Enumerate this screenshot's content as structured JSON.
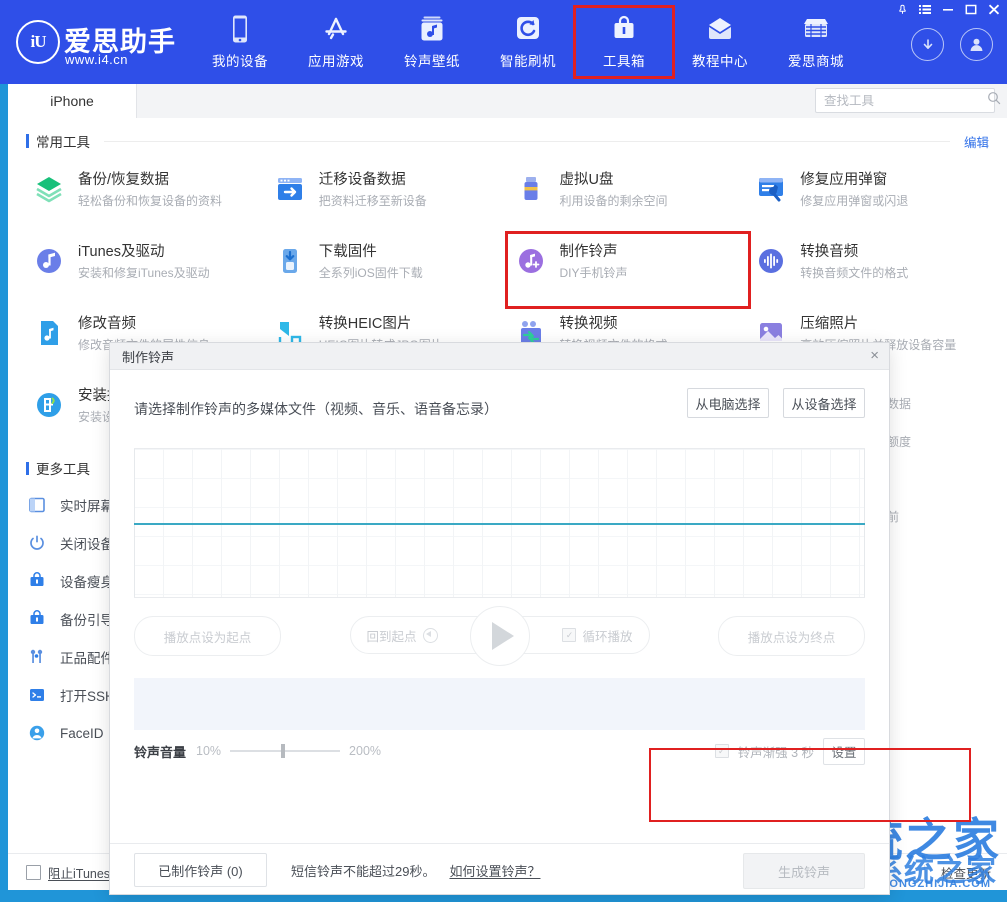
{
  "window": {
    "controls": [
      "pin-icon",
      "list-icon",
      "minimize-icon",
      "maximize-icon",
      "close-icon"
    ]
  },
  "brand": {
    "mark": "iU",
    "name": "爱思助手",
    "url": "www.i4.cn"
  },
  "nav": {
    "items": [
      {
        "label": "我的设备",
        "icon": "phone-icon"
      },
      {
        "label": "应用游戏",
        "icon": "appstore-icon"
      },
      {
        "label": "铃声壁纸",
        "icon": "music-box-icon"
      },
      {
        "label": "智能刷机",
        "icon": "refresh-icon"
      },
      {
        "label": "工具箱",
        "icon": "toolbox-icon",
        "selected": true
      },
      {
        "label": "教程中心",
        "icon": "envelope-icon"
      },
      {
        "label": "爱思商城",
        "icon": "shop-icon"
      }
    ],
    "right": [
      {
        "name": "download-icon"
      },
      {
        "name": "user-avatar-icon"
      }
    ],
    "highlight_color": "#e02020",
    "bar_color": "#2f4fe8"
  },
  "tabstrip": {
    "device_tab": "iPhone",
    "search_placeholder": "查找工具",
    "search_value": ""
  },
  "common_tools": {
    "title": "常用工具",
    "edit_label": "编辑",
    "items": [
      {
        "name": "备份/恢复数据",
        "desc": "轻松备份和恢复设备的资料",
        "icon": "layers-icon",
        "color": "#18c07a"
      },
      {
        "name": "迁移设备数据",
        "desc": "把资料迁移至新设备",
        "icon": "transfer-icon",
        "color": "#2f7fe8"
      },
      {
        "name": "虚拟U盘",
        "desc": "利用设备的剩余空间",
        "icon": "usb-icon",
        "color": "#6a7ee8"
      },
      {
        "name": "修复应用弹窗",
        "desc": "修复应用弹窗或闪退",
        "icon": "wrench-window-icon",
        "color": "#2f7fe8"
      },
      {
        "name": "iTunes及驱动",
        "desc": "安装和修复iTunes及驱动",
        "icon": "music-note-icon",
        "color": "#6a7ee8"
      },
      {
        "name": "下载固件",
        "desc": "全系列iOS固件下载",
        "icon": "download-box-icon",
        "color": "#2f9fe8"
      },
      {
        "name": "制作铃声",
        "desc": "DIY手机铃声",
        "icon": "ringtone-icon",
        "color": "#9b6fe0",
        "selected": true
      },
      {
        "name": "转换音频",
        "desc": "转换音频文件的格式",
        "icon": "waveform-icon",
        "color": "#5a6fe0"
      },
      {
        "name": "修改音频",
        "desc": "修改音频文件的属性信息",
        "icon": "audio-file-icon",
        "color": "#2f9fe8"
      },
      {
        "name": "转换HEIC图片",
        "desc": "HEIC图片转成JPG图片",
        "icon": "heic-icon",
        "color": "#2fb8e8"
      },
      {
        "name": "转换视频",
        "desc": "转换视频文件的格式",
        "icon": "video-convert-icon",
        "color": "#6a7ee8"
      },
      {
        "name": "压缩照片",
        "desc": "高效压缩照片并释放设备容量",
        "icon": "compress-photo-icon",
        "color": "#8a7fe0"
      },
      {
        "name": "安装描述文件",
        "desc": "安装设备描述文件",
        "icon": "install-profile-icon",
        "color": "#2f9fe8"
      }
    ]
  },
  "more_tools": {
    "title": "更多工具",
    "items": [
      {
        "label": "实时屏幕",
        "icon": "screen-icon"
      },
      {
        "label": "关闭设备",
        "icon": "power-icon"
      },
      {
        "label": "设备瘦身",
        "icon": "slim-icon"
      },
      {
        "label": "备份引导",
        "icon": "backup-icon"
      },
      {
        "label": "正品配件",
        "icon": "parts-icon"
      },
      {
        "label": "打开SSH",
        "icon": "terminal-icon"
      },
      {
        "label": "FaceID",
        "icon": "faceid-icon"
      }
    ],
    "right_fragments": [
      "数据",
      "额度",
      "前"
    ]
  },
  "statusbar": {
    "checkbox_label": "阻止iTunes运行",
    "checked": false,
    "right_items": [
      "检查更新"
    ]
  },
  "watermark": {
    "line1": "系统之家",
    "line2": "系统之家",
    "line3": "XITONGZHIJIA.COM"
  },
  "modal": {
    "title": "制作铃声",
    "close": "×",
    "prompt": "请选择制作铃声的多媒体文件（视频、音乐、语音备忘录）",
    "pick_from_pc": "从电脑选择",
    "pick_from_device": "从设备选择",
    "highlight_color": "#e02020",
    "controls": {
      "set_start": "播放点设为起点",
      "back_to_start": "回到起点",
      "loop_play": "循环播放",
      "loop_checked": true,
      "set_end": "播放点设为终点",
      "play_icon": "play-icon"
    },
    "volume": {
      "label": "铃声音量",
      "min": "10%",
      "max": "200%",
      "value_pct": 46
    },
    "fade": {
      "label": "铃声渐强 3 秒",
      "checked": true,
      "settings": "设置"
    },
    "footer": {
      "made_button": "已制作铃声 (0)",
      "note": "短信铃声不能超过29秒。",
      "link": "如何设置铃声？",
      "generate": "生成铃声"
    }
  }
}
